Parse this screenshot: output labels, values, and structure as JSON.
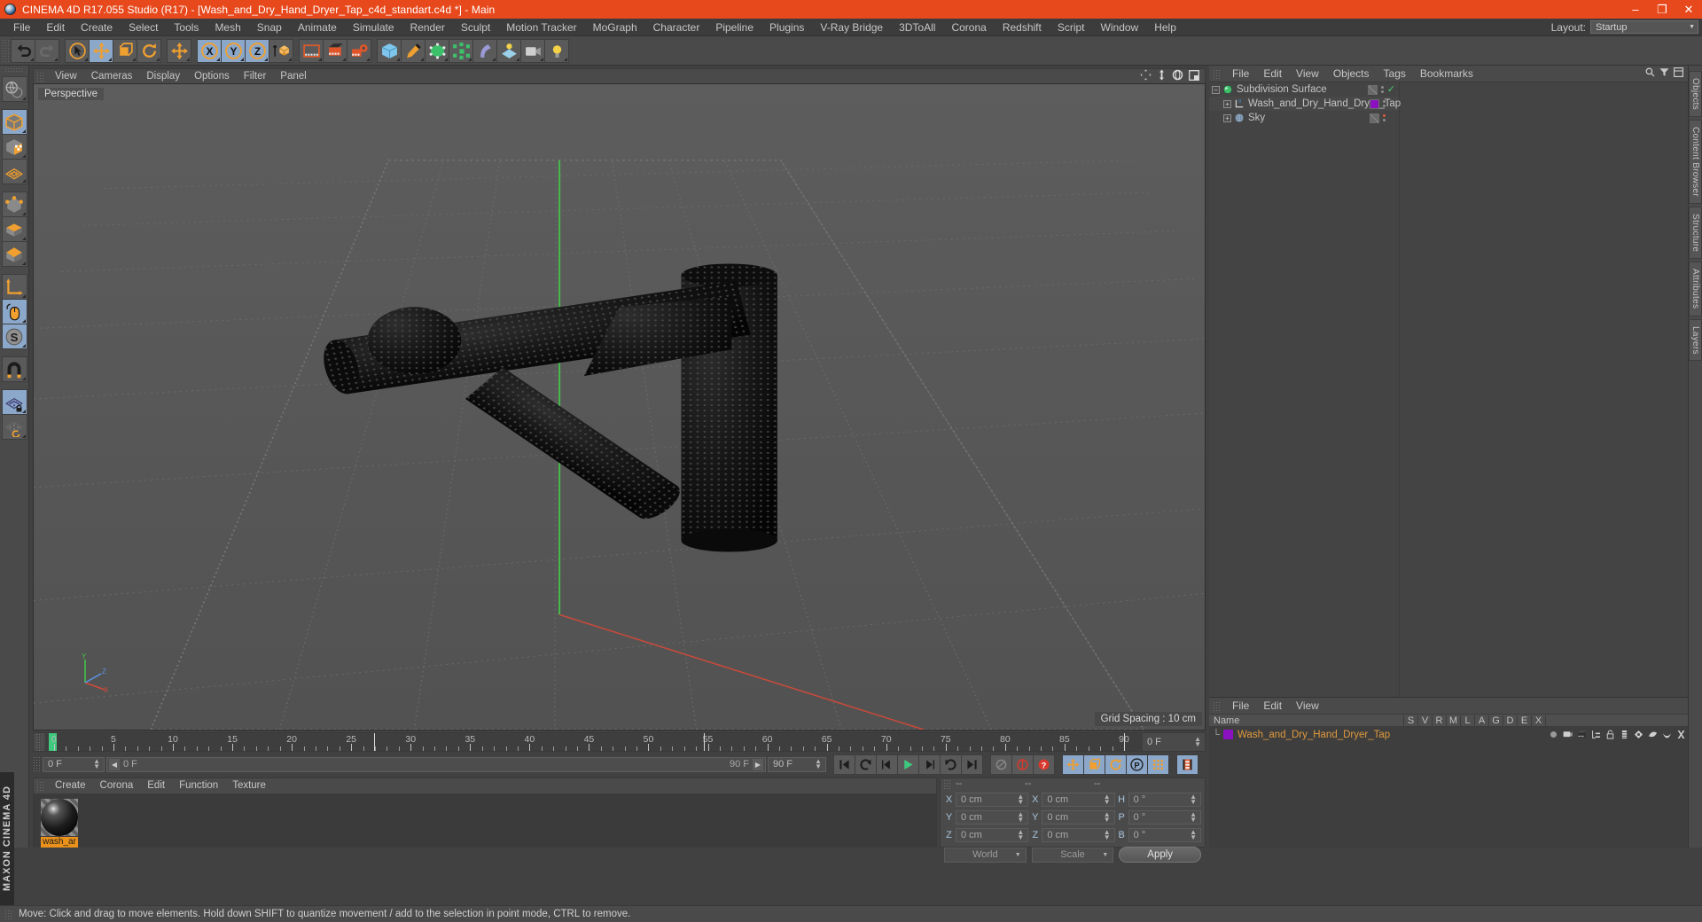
{
  "window": {
    "title": "CINEMA 4D R17.055 Studio (R17) - [Wash_and_Dry_Hand_Dryer_Tap_c4d_standart.c4d *] - Main",
    "minimize": "–",
    "maximize": "❐",
    "close": "✕"
  },
  "menubar": {
    "items": [
      {
        "label": "File"
      },
      {
        "label": "Edit"
      },
      {
        "label": "Create"
      },
      {
        "label": "Select"
      },
      {
        "label": "Tools"
      },
      {
        "label": "Mesh"
      },
      {
        "label": "Snap"
      },
      {
        "label": "Animate"
      },
      {
        "label": "Simulate"
      },
      {
        "label": "Render"
      },
      {
        "label": "Sculpt"
      },
      {
        "label": "Motion Tracker"
      },
      {
        "label": "MoGraph"
      },
      {
        "label": "Character"
      },
      {
        "label": "Pipeline"
      },
      {
        "label": "Plugins"
      },
      {
        "label": "V-Ray Bridge"
      },
      {
        "label": "3DToAll"
      },
      {
        "label": "Corona"
      },
      {
        "label": "Redshift"
      },
      {
        "label": "Script"
      },
      {
        "label": "Window"
      },
      {
        "label": "Help"
      }
    ],
    "layout_label": "Layout:",
    "layout_value": "Startup"
  },
  "toolbar": {
    "groups": [
      {
        "icons": [
          {
            "name": "undo-icon",
            "selected": false
          },
          {
            "name": "redo-icon",
            "selected": false
          }
        ]
      },
      {
        "icons": [
          {
            "name": "live-selection-icon",
            "selected": false
          },
          {
            "name": "move-tool-icon",
            "selected": true
          },
          {
            "name": "scale-tool-icon",
            "selected": false
          },
          {
            "name": "rotate-tool-icon",
            "selected": false
          }
        ]
      },
      {
        "icons": [
          {
            "name": "move-axis-icon",
            "selected": false
          }
        ]
      },
      {
        "icons": [
          {
            "name": "lock-x-axis-icon",
            "selected": true
          },
          {
            "name": "lock-y-axis-icon",
            "selected": true
          },
          {
            "name": "lock-z-axis-icon",
            "selected": true
          },
          {
            "name": "world-object-coordinates-icon",
            "selected": false
          }
        ]
      },
      {
        "icons": [
          {
            "name": "render-view-icon",
            "selected": false
          },
          {
            "name": "render-to-picture-viewer-icon",
            "selected": false
          },
          {
            "name": "render-settings-icon",
            "selected": false
          }
        ]
      },
      {
        "icons": [
          {
            "name": "cube-primitive-icon",
            "selected": false
          },
          {
            "name": "spline-pen-icon",
            "selected": false
          },
          {
            "name": "generator-nurbs-icon",
            "selected": false
          },
          {
            "name": "array-modeling-icon",
            "selected": false
          },
          {
            "name": "deformer-bend-icon",
            "selected": false
          },
          {
            "name": "environment-floor-icon",
            "selected": false
          },
          {
            "name": "camera-icon",
            "selected": false
          },
          {
            "name": "light-icon",
            "selected": false
          }
        ]
      }
    ]
  },
  "left_tools": [
    {
      "name": "model-make-editable-icon",
      "selected": false
    },
    {
      "name": "model-mode-icon",
      "selected": true
    },
    {
      "name": "texture-mode-icon",
      "selected": false
    },
    {
      "name": "polygon-grid-icon",
      "selected": false
    },
    {
      "name": "point-mode-icon",
      "selected": false
    },
    {
      "name": "edge-mode-icon",
      "selected": false
    },
    {
      "name": "polygon-mode-icon",
      "selected": false
    },
    {
      "name": "axis-modification-icon",
      "selected": false
    },
    {
      "name": "viewport-solo-mouse-icon",
      "selected": true
    },
    {
      "name": "enable-snapping-s-icon",
      "selected": true
    },
    {
      "name": "magnet-tool-icon",
      "selected": false
    },
    {
      "name": "workplane-lock-icon",
      "selected": true
    },
    {
      "name": "workplane-rotate-icon",
      "selected": false
    }
  ],
  "viewport": {
    "menu": [
      {
        "label": "View"
      },
      {
        "label": "Cameras"
      },
      {
        "label": "Display"
      },
      {
        "label": "Options"
      },
      {
        "label": "Filter"
      },
      {
        "label": "Panel"
      }
    ],
    "label": "Perspective",
    "grid_spacing": "Grid Spacing : 10 cm",
    "nav_icons": [
      {
        "name": "pan-view-icon"
      },
      {
        "name": "dolly-view-icon"
      },
      {
        "name": "rotate-view-icon"
      },
      {
        "name": "toggle-layout-icon"
      }
    ],
    "axis_labels": {
      "y": "Y",
      "z": "Z",
      "x": "X"
    }
  },
  "timeline": {
    "ticks": [
      0,
      5,
      10,
      15,
      20,
      25,
      30,
      35,
      40,
      45,
      50,
      55,
      60,
      65,
      70,
      75,
      80,
      85,
      90
    ],
    "current_frame": "0 F",
    "range_start": "0 F",
    "range_end": "90 F",
    "end_field": "90 F",
    "preview_field": "0 F",
    "transport": [
      {
        "name": "go-to-start-button",
        "selected": false
      },
      {
        "name": "previous-keyframe-button",
        "selected": false
      },
      {
        "name": "previous-frame-button",
        "selected": false
      },
      {
        "name": "play-button",
        "selected": false
      },
      {
        "name": "next-frame-button",
        "selected": false
      },
      {
        "name": "next-keyframe-button",
        "selected": false
      },
      {
        "name": "go-to-end-button",
        "selected": false
      }
    ],
    "record_group": [
      {
        "name": "record-active-objects-button",
        "selected": false
      },
      {
        "name": "autokeying-button",
        "selected": false
      },
      {
        "name": "keyframe-selection-button",
        "selected": false
      }
    ],
    "key_group": [
      {
        "name": "key-position-button",
        "selected": true
      },
      {
        "name": "key-scale-button",
        "selected": true
      },
      {
        "name": "key-rotation-button",
        "selected": true
      },
      {
        "name": "key-parameter-button",
        "selected": true
      },
      {
        "name": "key-point-level-animation-button",
        "selected": true
      }
    ],
    "extra": [
      {
        "name": "timeline-view-button",
        "selected": true
      }
    ]
  },
  "material_manager": {
    "menu": [
      {
        "label": "Create"
      },
      {
        "label": "Corona"
      },
      {
        "label": "Edit"
      },
      {
        "label": "Function"
      },
      {
        "label": "Texture"
      }
    ],
    "materials": [
      {
        "name": "wash_ar"
      }
    ]
  },
  "coordinates": {
    "header": [
      "--",
      "--",
      "--"
    ],
    "rows": [
      {
        "axis": "X",
        "position": "0 cm",
        "axis2": "X",
        "size": "0 cm",
        "axis3": "H",
        "rot": "0 °"
      },
      {
        "axis": "Y",
        "position": "0 cm",
        "axis2": "Y",
        "size": "0 cm",
        "axis3": "P",
        "rot": "0 °"
      },
      {
        "axis": "Z",
        "position": "0 cm",
        "axis2": "Z",
        "size": "0 cm",
        "axis3": "B",
        "rot": "0 °"
      }
    ],
    "coord_system": "World",
    "size_mode": "Scale",
    "apply_label": "Apply"
  },
  "object_manager": {
    "menu": [
      {
        "label": "File"
      },
      {
        "label": "Edit"
      },
      {
        "label": "View"
      },
      {
        "label": "Objects"
      },
      {
        "label": "Tags"
      },
      {
        "label": "Bookmarks"
      }
    ],
    "tools": [
      {
        "name": "om-search-icon"
      },
      {
        "name": "om-filter-icon"
      },
      {
        "name": "om-layout-icon"
      }
    ],
    "objects": [
      {
        "name": "Subdivision Surface",
        "icon": "subdivision-surface-icon",
        "indent": 0,
        "expanded": true,
        "tag_color": "#6a6a6a",
        "check": true
      },
      {
        "name": "Wash_and_Dry_Hand_Dryer_Tap",
        "icon": "null-object-icon",
        "indent": 1,
        "expanded": false,
        "tag_color": "#8a10c0",
        "check": false
      },
      {
        "name": "Sky",
        "icon": "sky-object-icon",
        "indent": 1,
        "expanded": false,
        "tag_color": "#6a6a6a",
        "check": false,
        "dot": "#e05a3a"
      }
    ]
  },
  "layer_manager": {
    "menu": [
      {
        "label": "File"
      },
      {
        "label": "Edit"
      },
      {
        "label": "View"
      }
    ],
    "columns": [
      "Name",
      "S",
      "V",
      "R",
      "M",
      "L",
      "A",
      "G",
      "D",
      "E",
      "X"
    ],
    "column_icons": [
      "solo-icon",
      "visible-icon",
      "render-icon",
      "manager-icon",
      "lock-icon",
      "animation-icon",
      "generators-icon",
      "deformers-icon",
      "expressions-icon",
      "xref-icon"
    ],
    "rows": [
      {
        "name": "Wash_and_Dry_Hand_Dryer_Tap",
        "color": "#8a10c0"
      }
    ]
  },
  "right_dock": {
    "tabs": [
      "Objects",
      "Content Browser",
      "Structure",
      "Attributes",
      "Layers"
    ]
  },
  "brand": "MAXON CINEMA 4D",
  "statusbar": {
    "text": "Move: Click and drag to move elements. Hold down SHIFT to quantize movement / add to the selection in point mode, CTRL to remove."
  },
  "colors": {
    "accent": "#e8491c",
    "selection": "#8ba7c9",
    "orange_icon": "#f0a030",
    "material_tag": "#8a10c0",
    "playhead": "#3ec97e"
  }
}
